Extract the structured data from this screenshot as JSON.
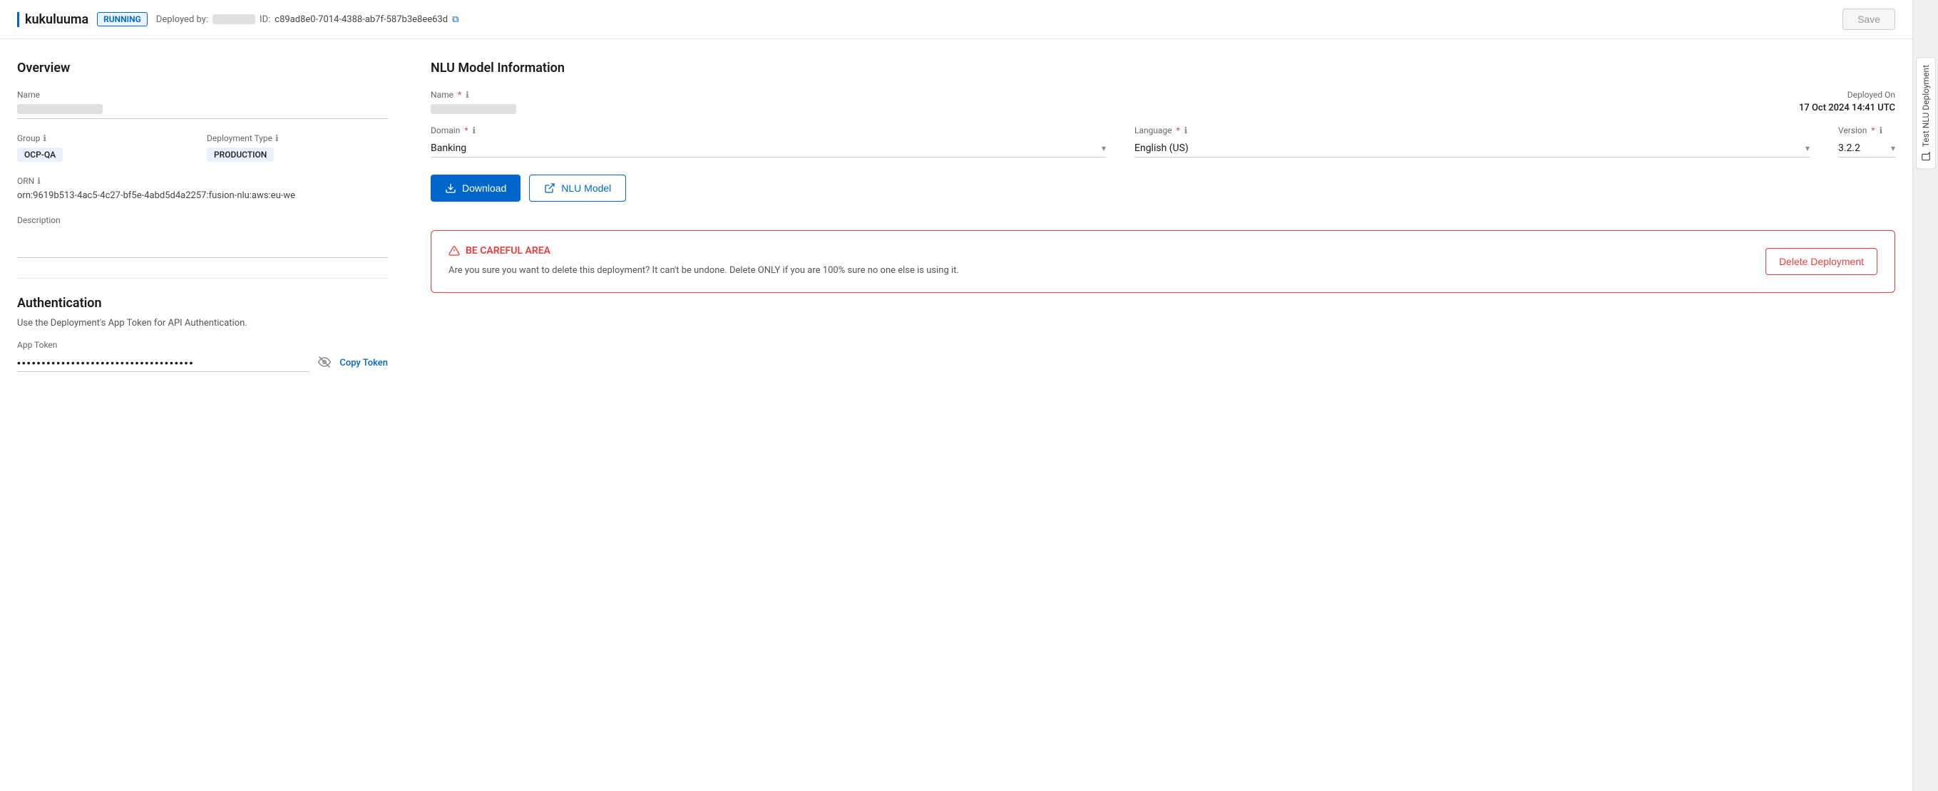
{
  "topbar": {
    "title": "kukuluuma",
    "status": "RUNNING",
    "deployed_by_label": "Deployed by:",
    "id_label": "ID:",
    "deployment_id": "c89ad8e0-7014-4388-ab7f-587b3e8ee63d",
    "save_label": "Save"
  },
  "overview": {
    "section_title": "Overview",
    "name_label": "Name",
    "group_label": "Group",
    "group_info": "ℹ",
    "group_value": "OCP-QA",
    "deployment_type_label": "Deployment Type",
    "deployment_type_info": "ℹ",
    "deployment_type_value": "PRODUCTION",
    "orn_label": "ORN",
    "orn_info": "ℹ",
    "orn_value": "orn:9619b513-4ac5-4c27-bf5e-4abd5d4a2257:fusion-nlu:aws:eu-we",
    "description_label": "Description"
  },
  "authentication": {
    "section_title": "Authentication",
    "description": "Use the Deployment's App Token for API Authentication.",
    "app_token_label": "App Token",
    "token_masked": "••••••••••••••••••••••••••••••••••••",
    "copy_token_label": "Copy Token"
  },
  "nlu_model": {
    "section_title": "NLU Model Information",
    "name_label": "Name",
    "name_info": "ℹ",
    "deployed_on_label": "Deployed On",
    "deployed_on_value": "17 Oct 2024 14:41 UTC",
    "domain_label": "Domain",
    "domain_info": "ℹ",
    "domain_value": "Banking",
    "language_label": "Language",
    "language_info": "ℹ",
    "language_value": "English (US)",
    "version_label": "Version",
    "version_info": "ℹ",
    "version_value": "3.2.2",
    "download_label": "Download",
    "nlu_model_label": "NLU Model"
  },
  "danger": {
    "title": "BE CAREFUL AREA",
    "text": "Are you sure you want to delete this deployment? It can't be undone. Delete ONLY if you are 100% sure no one else is using it.",
    "delete_label": "Delete Deployment"
  },
  "sidebar": {
    "tab_label": "Test NLU Deployment"
  }
}
